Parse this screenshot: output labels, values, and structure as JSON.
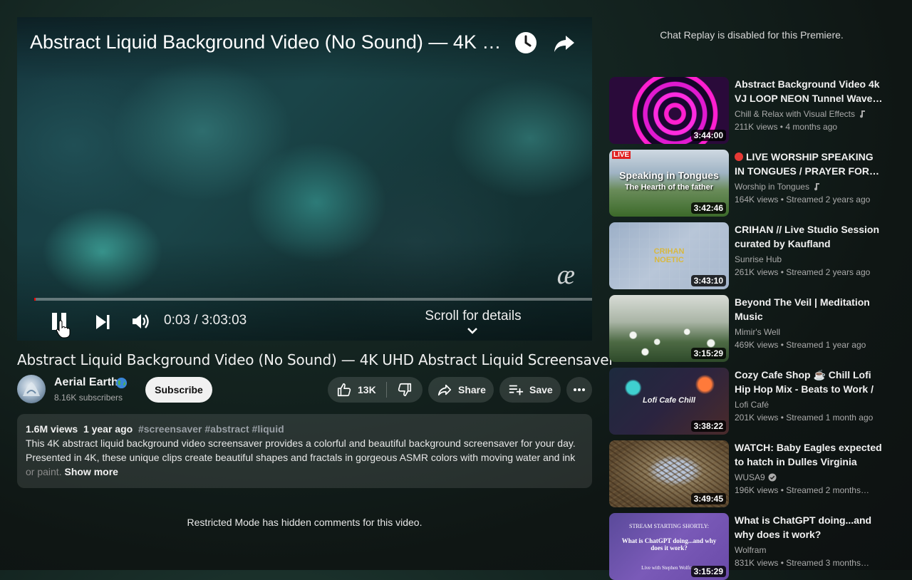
{
  "player": {
    "overlay_title": "Abstract Liquid Background Video (No Sound) — 4K UHD Abstract Liquid Screensaver",
    "watermark": "æ",
    "progress": 0.0003,
    "time_display": "0:03 / 3:03:03",
    "scroll_hint": "Scroll for details",
    "colors": {
      "progress": "#ff0000"
    }
  },
  "video": {
    "title": "Abstract Liquid Background Video (No Sound) — 4K UHD Abstract Liquid Screensaver",
    "channel": {
      "name": "Aerial Earth",
      "subscribers": "8.16K subscribers",
      "subscribe_label": "Subscribe"
    },
    "actions": {
      "likes": "13K",
      "share_label": "Share",
      "save_label": "Save"
    },
    "description": {
      "views": "1.6M views",
      "age": "1 year ago",
      "tags": "#screensaver #abstract #liquid",
      "text_visible": "This 4K abstract liquid background video screensaver provides a colorful and beautiful background screensaver for your day. Presented in 4K, these unique clips create beautiful shapes and fractals in gorgeous ASMR colors with moving water and ink",
      "text_faded": "or paint.",
      "show_more": "Show more"
    },
    "comments_notice": "Restricted Mode has hidden comments for this video."
  },
  "sidebar": {
    "chat_notice": "Chat Replay is disabled for this Premiere.",
    "recommendations": [
      {
        "title": "Abstract Background Video 4k VJ LOOP NEON Tunnel Wave…",
        "channel": "Chill & Relax with Visual Effects",
        "badge": "music-note-icon",
        "meta": "211K views  •  4 months ago",
        "duration": "3:44:00",
        "thumb_colors": [
          "#ff1fd0",
          "#2a0a3a"
        ]
      },
      {
        "title": "LIVE WORSHIP SPEAKING IN TONGUES / PRAYER FOR…",
        "live_dot": true,
        "channel": "Worship in Tongues",
        "badge": "music-note-icon",
        "meta": "164K views  •  Streamed 2 years ago",
        "duration": "3:42:46",
        "thumb_label_live": "LIVE",
        "thumb_line1": "Speaking in Tongues",
        "thumb_line2": "The Hearth of the father"
      },
      {
        "title": "CRIHAN // Live Studio Session curated by Kaufland",
        "channel": "Sunrise Hub",
        "meta": "261K views  •  Streamed 2 years ago",
        "duration": "3:43:10",
        "thumb_text": "CRIHAN\nNOETIC"
      },
      {
        "title": "Beyond The Veil | Meditation Music",
        "channel": "Mimir's Well",
        "meta": "469K views  •  Streamed 1 year ago",
        "duration": "3:15:29"
      },
      {
        "title": "Cozy Cafe Shop ☕ Chill Lofi Hip Hop Mix - Beats to Work / Stu…",
        "channel": "Lofi Café",
        "meta": "201K views  •  Streamed 1 month ago",
        "duration": "3:38:22",
        "thumb_text": "Lofi Cafe Chill"
      },
      {
        "title": "WATCH: Baby Eagles expected to hatch in Dulles Virginia",
        "channel": "WUSA9",
        "badge": "verified-icon",
        "meta": "196K views  •  Streamed 2 months…",
        "duration": "3:49:45"
      },
      {
        "title": "What is ChatGPT doing...and why does it work?",
        "channel": "Wolfram",
        "meta": "831K views  •  Streamed 3 months…",
        "duration": "3:15:29",
        "thumb_line1": "STREAM STARTING SHORTLY:",
        "thumb_line2": "What is ChatGPT doing...and why does it work?",
        "thumb_line3": "Live with Stephen Wolfram"
      }
    ]
  }
}
